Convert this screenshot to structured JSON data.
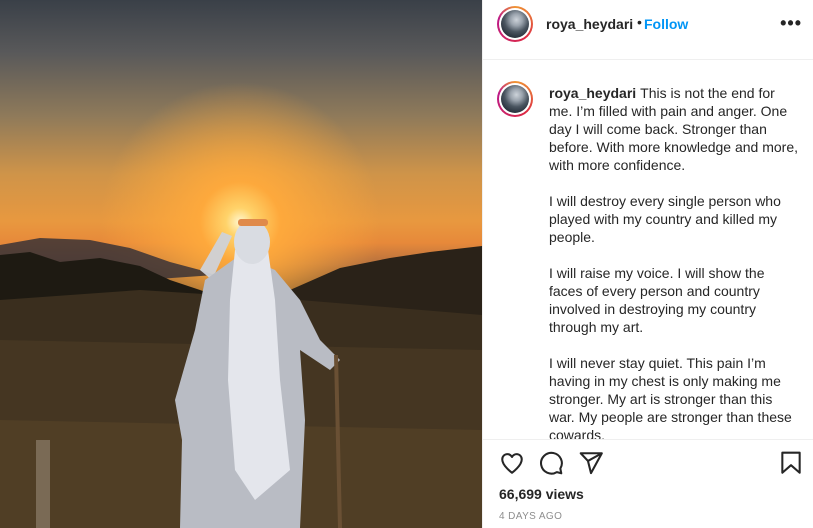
{
  "post": {
    "author": "roya_heydari",
    "follow_label": "Follow",
    "separator": "•",
    "more_label": "•••",
    "caption_paragraphs": [
      "This is not the end for me. I’m filled with pain and anger. One day I will come back. Stronger than before. With more knowledge and more, with more confidence.",
      "I will destroy every single person who played with my country and killed my people.",
      "I will raise my voice. I will show the faces of every person and country involved in destroying my country through my art.",
      "I will never stay quiet. This pain I’m having in my chest is only making me stronger. My art is stronger than this war. My people are stronger than these cowards."
    ],
    "views": "66,699 views",
    "date": "4 DAYS AGO"
  },
  "icons": [
    "heart-icon",
    "comment-icon",
    "share-icon",
    "bookmark-icon",
    "more-options-icon"
  ],
  "colors": {
    "link": "#0095f6",
    "text": "#262626",
    "muted": "#8e8e8e"
  }
}
